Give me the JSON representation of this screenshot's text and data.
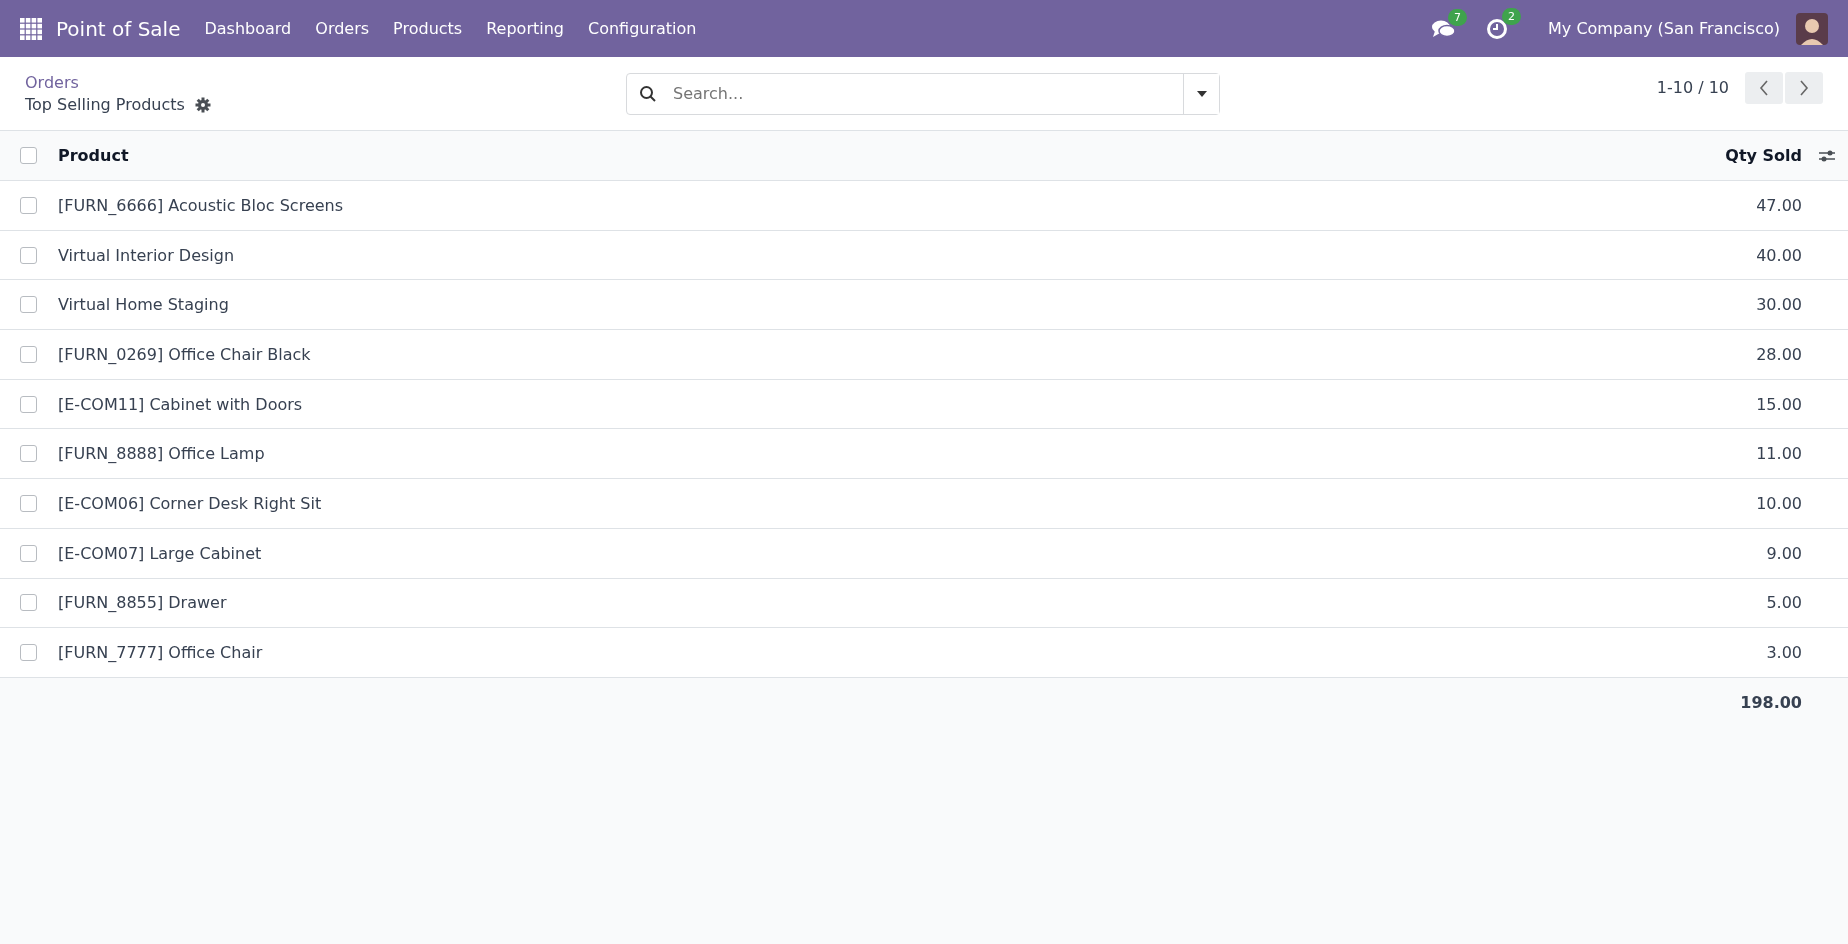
{
  "navbar": {
    "app_name": "Point of Sale",
    "menu": [
      {
        "label": "Dashboard"
      },
      {
        "label": "Orders"
      },
      {
        "label": "Products"
      },
      {
        "label": "Reporting"
      },
      {
        "label": "Configuration"
      }
    ],
    "messages_count": "7",
    "activities_count": "2",
    "company": "My Company (San Francisco)"
  },
  "control_panel": {
    "breadcrumb": "Orders",
    "title": "Top Selling Products",
    "search": {
      "placeholder": "Search..."
    },
    "pager": "1-10 / 10"
  },
  "table": {
    "select_all": {
      "checked": false
    },
    "columns": [
      "Product",
      "Qty Sold"
    ],
    "rows": [
      {
        "product": "[FURN_6666] Acoustic Bloc Screens",
        "qty": "47.00",
        "selected": false
      },
      {
        "product": "Virtual Interior Design",
        "qty": "40.00",
        "selected": false
      },
      {
        "product": "Virtual Home Staging",
        "qty": "30.00",
        "selected": false
      },
      {
        "product": "[FURN_0269] Office Chair Black",
        "qty": "28.00",
        "selected": false
      },
      {
        "product": "[E-COM11] Cabinet with Doors",
        "qty": "15.00",
        "selected": false
      },
      {
        "product": "[FURN_8888] Office Lamp",
        "qty": "11.00",
        "selected": false
      },
      {
        "product": "[E-COM06] Corner Desk Right Sit",
        "qty": "10.00",
        "selected": false
      },
      {
        "product": "[E-COM07] Large Cabinet",
        "qty": "9.00",
        "selected": false
      },
      {
        "product": "[FURN_8855] Drawer",
        "qty": "5.00",
        "selected": false
      },
      {
        "product": "[FURN_7777] Office Chair",
        "qty": "3.00",
        "selected": false
      }
    ],
    "total": "198.00"
  }
}
